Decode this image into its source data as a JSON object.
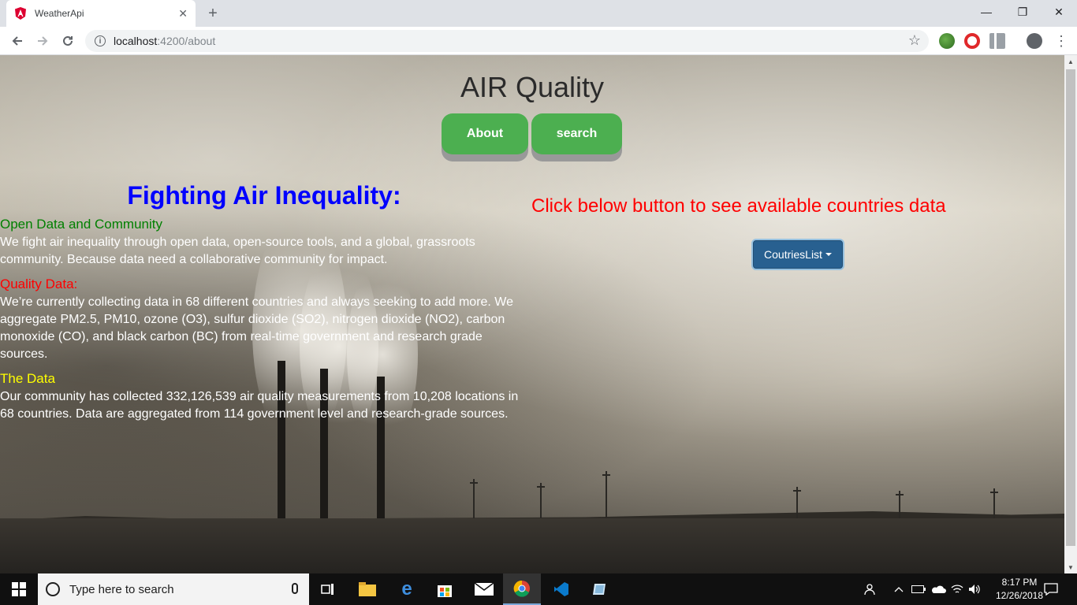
{
  "browser": {
    "tab_title": "WeatherApi",
    "tab_close": "✕",
    "new_tab": "+",
    "url_host": "localhost",
    "url_path": ":4200/about",
    "window_controls": [
      "—",
      "❐",
      "✕"
    ]
  },
  "page": {
    "heading": "AIR Quality",
    "nav": {
      "about": "About",
      "search": "search"
    },
    "main_heading": "Fighting Air Inequality:",
    "sections": [
      {
        "title": "Open Data and Community",
        "title_color": "#008000",
        "body": "We fight air inequality through open data, open-source tools, and a global, grassroots community. Because data need a collaborative community for impact."
      },
      {
        "title": "Quality Data:",
        "title_color": "#ff0000",
        "body": "We’re currently collecting data in 68 different countries and always seeking to add more. We aggregate PM2.5, PM10, ozone (O3), sulfur dioxide (SO2), nitrogen dioxide (NO2), carbon monoxide (CO), and black carbon (BC) from real-time government and research grade sources."
      },
      {
        "title": "The Data",
        "title_color": "#ffff00",
        "body": "Our community has collected 332,126,539 air quality measurements from 10,208 locations in 68 countries. Data are aggregated from 114 government level and research-grade sources."
      }
    ],
    "right_prompt": "Click below button to see available countries data",
    "countries_button": "CoutriesList"
  },
  "taskbar": {
    "search_placeholder": "Type here to search",
    "time": "8:17 PM",
    "date": "12/26/2018"
  },
  "colors": {
    "button_green": "#4caf50",
    "dropdown_blue": "#286090",
    "heading_blue": "#0000ff",
    "prompt_red": "#ff0000"
  }
}
